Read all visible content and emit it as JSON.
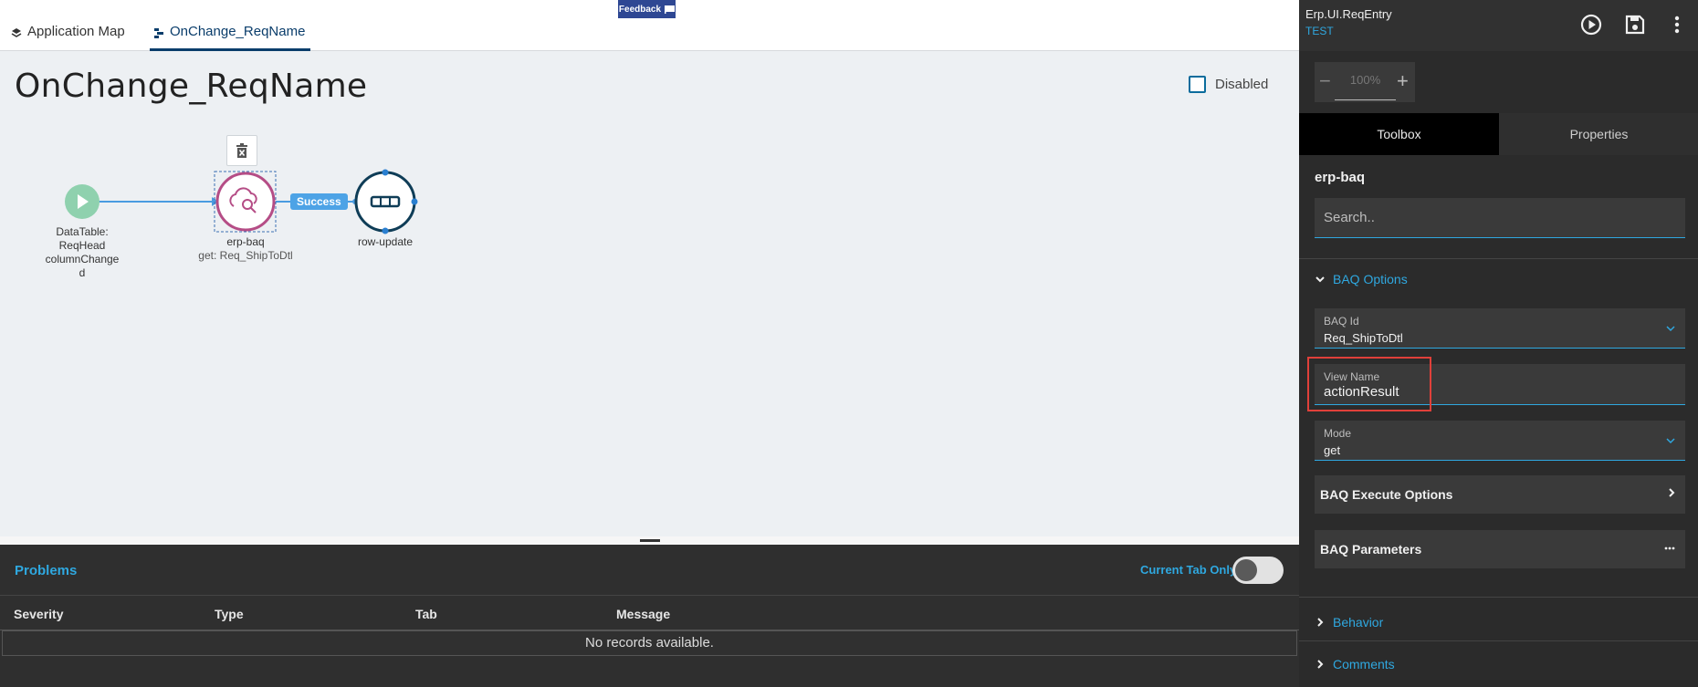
{
  "tabs": {
    "application_map": "Application Map",
    "current": "OnChange_ReqName"
  },
  "feedback_label": "Feedback",
  "page_title": "OnChange_ReqName",
  "disabled_label": "Disabled",
  "flow": {
    "start_node": [
      "DataTable:",
      "ReqHead",
      "columnChange",
      "d"
    ],
    "baq_node_name": "erp-baq",
    "baq_node_sub": "get: Req_ShipToDtl",
    "success_label": "Success",
    "update_node_name": "row-update"
  },
  "problems": {
    "title": "Problems",
    "current_tab_only": "Current Tab Only",
    "columns": [
      "Severity",
      "Type",
      "Tab",
      "Message"
    ],
    "empty_message": "No records available."
  },
  "right_panel": {
    "title": "Erp.UI.ReqEntry",
    "subtitle": "TEST",
    "zoom_value": "100%",
    "tab_toolbox": "Toolbox",
    "tab_properties": "Properties",
    "tool_name": "erp-baq",
    "search_placeholder": "Search..",
    "baq_options": "BAQ Options",
    "baq_id_label": "BAQ Id",
    "baq_id_value": "Req_ShipToDtl",
    "view_name_label": "View Name",
    "view_name_value": "actionResult",
    "mode_label": "Mode",
    "mode_value": "get",
    "baq_execute_options": "BAQ Execute Options",
    "baq_parameters": "BAQ Parameters",
    "behavior": "Behavior",
    "comments": "Comments"
  },
  "colors": {
    "accent": "#2fa8e0",
    "node_start": "#8fd1ae",
    "node_baq": "#b54d86",
    "node_update": "#0f3d57",
    "highlight": "#e0403a"
  }
}
